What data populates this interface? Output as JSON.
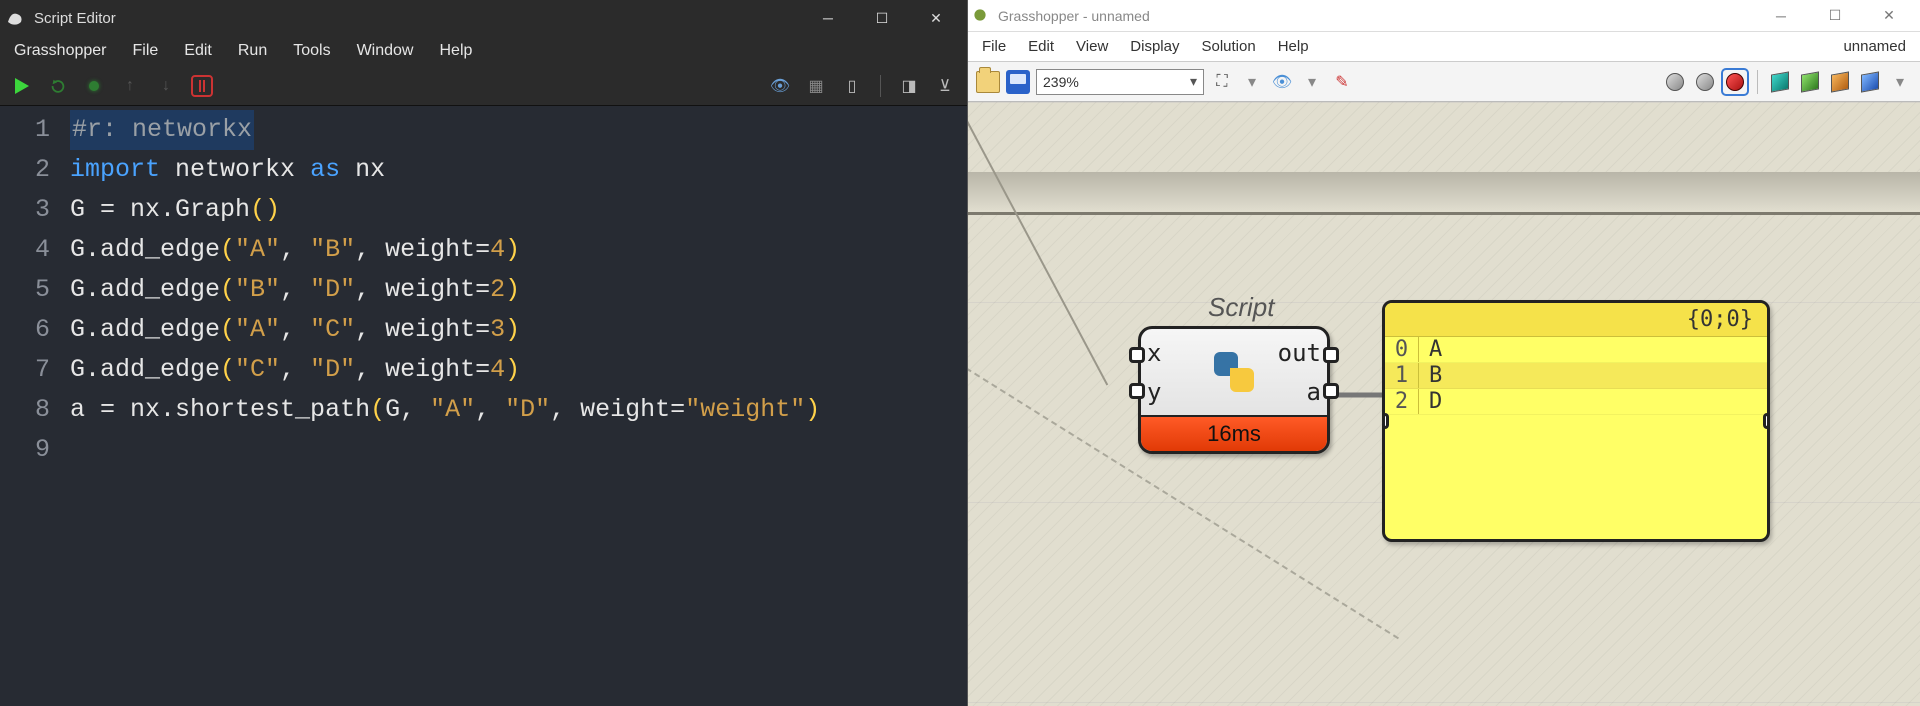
{
  "script_editor": {
    "title": "Script Editor",
    "menu": [
      "Grasshopper",
      "File",
      "Edit",
      "Run",
      "Tools",
      "Window",
      "Help"
    ],
    "code_lines": [
      {
        "n": "1",
        "seg": [
          {
            "t": "#r: networkx",
            "c": "comment-sel"
          }
        ]
      },
      {
        "n": "2",
        "seg": [
          {
            "t": "import ",
            "c": "kw"
          },
          {
            "t": "networkx ",
            "c": "plain"
          },
          {
            "t": "as ",
            "c": "kw"
          },
          {
            "t": "nx",
            "c": "plain"
          }
        ]
      },
      {
        "n": "3",
        "seg": [
          {
            "t": "G ",
            "c": "plain"
          },
          {
            "t": "= ",
            "c": "eq"
          },
          {
            "t": "nx.Graph",
            "c": "plain"
          },
          {
            "t": "()",
            "c": "paren"
          }
        ]
      },
      {
        "n": "4",
        "seg": [
          {
            "t": "G.add_edge",
            "c": "plain"
          },
          {
            "t": "(",
            "c": "paren"
          },
          {
            "t": "\"A\"",
            "c": "str"
          },
          {
            "t": ", ",
            "c": "plain"
          },
          {
            "t": "\"B\"",
            "c": "str"
          },
          {
            "t": ", weight=",
            "c": "plain"
          },
          {
            "t": "4",
            "c": "num"
          },
          {
            "t": ")",
            "c": "paren"
          }
        ]
      },
      {
        "n": "5",
        "seg": [
          {
            "t": "G.add_edge",
            "c": "plain"
          },
          {
            "t": "(",
            "c": "paren"
          },
          {
            "t": "\"B\"",
            "c": "str"
          },
          {
            "t": ", ",
            "c": "plain"
          },
          {
            "t": "\"D\"",
            "c": "str"
          },
          {
            "t": ", weight=",
            "c": "plain"
          },
          {
            "t": "2",
            "c": "num"
          },
          {
            "t": ")",
            "c": "paren"
          }
        ]
      },
      {
        "n": "6",
        "seg": [
          {
            "t": "G.add_edge",
            "c": "plain"
          },
          {
            "t": "(",
            "c": "paren"
          },
          {
            "t": "\"A\"",
            "c": "str"
          },
          {
            "t": ", ",
            "c": "plain"
          },
          {
            "t": "\"C\"",
            "c": "str"
          },
          {
            "t": ", weight=",
            "c": "plain"
          },
          {
            "t": "3",
            "c": "num"
          },
          {
            "t": ")",
            "c": "paren"
          }
        ]
      },
      {
        "n": "7",
        "seg": [
          {
            "t": "G.add_edge",
            "c": "plain"
          },
          {
            "t": "(",
            "c": "paren"
          },
          {
            "t": "\"C\"",
            "c": "str"
          },
          {
            "t": ", ",
            "c": "plain"
          },
          {
            "t": "\"D\"",
            "c": "str"
          },
          {
            "t": ", weight=",
            "c": "plain"
          },
          {
            "t": "4",
            "c": "num"
          },
          {
            "t": ")",
            "c": "paren"
          }
        ]
      },
      {
        "n": "8",
        "seg": [
          {
            "t": "a ",
            "c": "plain"
          },
          {
            "t": "= ",
            "c": "eq"
          },
          {
            "t": "nx.shortest_path",
            "c": "plain"
          },
          {
            "t": "(",
            "c": "paren"
          },
          {
            "t": "G, ",
            "c": "plain"
          },
          {
            "t": "\"A\"",
            "c": "str"
          },
          {
            "t": ", ",
            "c": "plain"
          },
          {
            "t": "\"D\"",
            "c": "str"
          },
          {
            "t": ", weight=",
            "c": "plain"
          },
          {
            "t": "\"weight\"",
            "c": "str"
          },
          {
            "t": ")",
            "c": "paren"
          }
        ]
      },
      {
        "n": "9",
        "seg": []
      }
    ]
  },
  "grasshopper": {
    "title": "Grasshopper - unnamed",
    "doc_name": "unnamed",
    "menu": [
      "File",
      "Edit",
      "View",
      "Display",
      "Solution",
      "Help"
    ],
    "zoom": "239%",
    "script_label": "Script",
    "component": {
      "inputs": [
        "x",
        "y"
      ],
      "outputs": [
        "out",
        "a"
      ],
      "footer": "16ms"
    },
    "panel": {
      "header": "{0;0}",
      "rows": [
        {
          "idx": "0",
          "val": "A"
        },
        {
          "idx": "1",
          "val": "B"
        },
        {
          "idx": "2",
          "val": "D"
        }
      ]
    }
  }
}
